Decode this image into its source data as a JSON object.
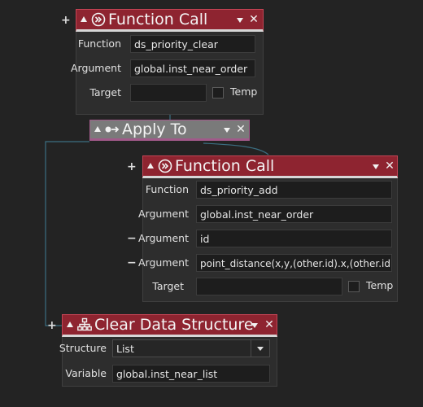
{
  "blocks": {
    "function_call_1": {
      "title": "Function Call",
      "rows": [
        {
          "label": "Function",
          "value": "ds_priority_clear"
        },
        {
          "label": "Argument",
          "value": "global.inst_near_order"
        },
        {
          "label": "Target",
          "value": ""
        }
      ],
      "temp_label": "Temp"
    },
    "apply_to": {
      "title": "Apply To"
    },
    "function_call_2": {
      "title": "Function Call",
      "rows": [
        {
          "label": "Function",
          "value": "ds_priority_add"
        },
        {
          "label": "Argument",
          "value": "global.inst_near_order"
        },
        {
          "label": "Argument",
          "value": "id"
        },
        {
          "label": "Argument",
          "value": "point_distance(x,y,(other.id).x,(other.id).y)"
        },
        {
          "label": "Target",
          "value": ""
        }
      ],
      "temp_label": "Temp"
    },
    "clear_data_structure": {
      "title": "Clear Data Structure",
      "structure_label": "Structure",
      "structure_value": "List",
      "variable_label": "Variable",
      "variable_value": "global.inst_near_list"
    }
  },
  "symbols": {
    "plus": "+",
    "minus": "−",
    "close": "✕"
  },
  "icons": {
    "function_call": "function-call-icon",
    "apply_to": "apply-to-icon",
    "clear_data_structure": "hierarchy-icon"
  },
  "colors": {
    "background": "#232323",
    "header_red": "#8e2430",
    "header_gray": "#7a7a7a",
    "panel": "#2d2d2d",
    "field": "#1d1d1d",
    "wire": "#3b6f82"
  }
}
